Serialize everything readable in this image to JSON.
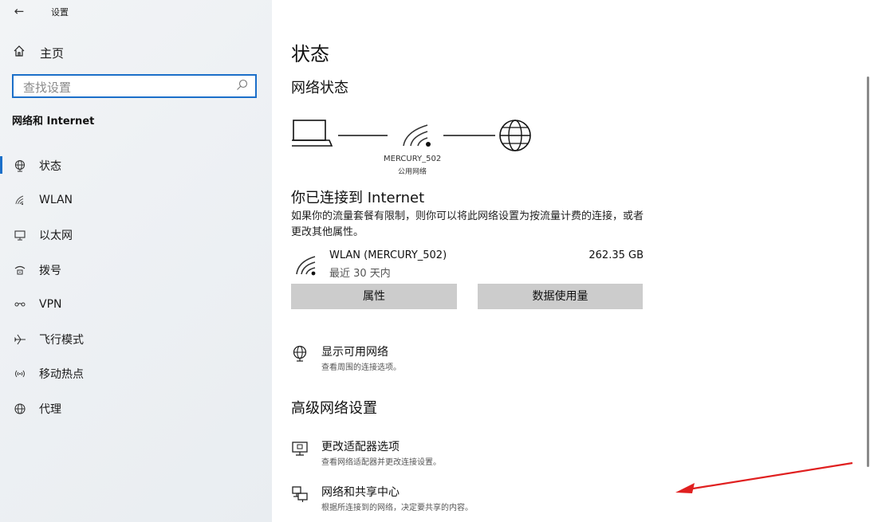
{
  "window": {
    "back_glyph": "←",
    "title": "设置",
    "controls": {
      "minimize": "–",
      "maximize": "☐",
      "close": "✕"
    }
  },
  "sidebar": {
    "home_label": "主页",
    "search_placeholder": "查找设置",
    "section_title": "网络和 Internet",
    "items": [
      {
        "label": "状态",
        "icon": "globe-status-icon",
        "active": true
      },
      {
        "label": "WLAN",
        "icon": "wifi-icon",
        "active": false
      },
      {
        "label": "以太网",
        "icon": "ethernet-icon",
        "active": false
      },
      {
        "label": "拨号",
        "icon": "dialup-icon",
        "active": false
      },
      {
        "label": "VPN",
        "icon": "vpn-icon",
        "active": false
      },
      {
        "label": "飞行模式",
        "icon": "airplane-icon",
        "active": false
      },
      {
        "label": "移动热点",
        "icon": "hotspot-icon",
        "active": false
      },
      {
        "label": "代理",
        "icon": "globe-proxy-icon",
        "active": false
      }
    ]
  },
  "main": {
    "title": "状态",
    "network_status_title": "网络状态",
    "network": {
      "ssid": "MERCURY_502",
      "type": "公用网络"
    },
    "connected_title": "你已连接到 Internet",
    "connected_desc": "如果你的流量套餐有限制，则你可以将此网络设置为按流量计费的连接，或者更改其他属性。",
    "wlan": {
      "name": "WLAN (MERCURY_502)",
      "period": "最近 30 天内",
      "usage": "262.35 GB"
    },
    "buttons": {
      "properties": "属性",
      "data_usage": "数据使用量"
    },
    "show_networks": {
      "title": "显示可用网络",
      "desc": "查看周围的连接选项。"
    },
    "advanced_title": "高级网络设置",
    "adapter_options": {
      "title": "更改适配器选项",
      "desc": "查看网络适配器并更改连接设置。"
    },
    "sharing_center": {
      "title": "网络和共享中心",
      "desc": "根据所连接到的网络，决定要共享的内容。"
    }
  },
  "colors": {
    "accent": "#1b6fc9",
    "button_bg": "#cccccc",
    "annotation_arrow": "#e02020"
  }
}
